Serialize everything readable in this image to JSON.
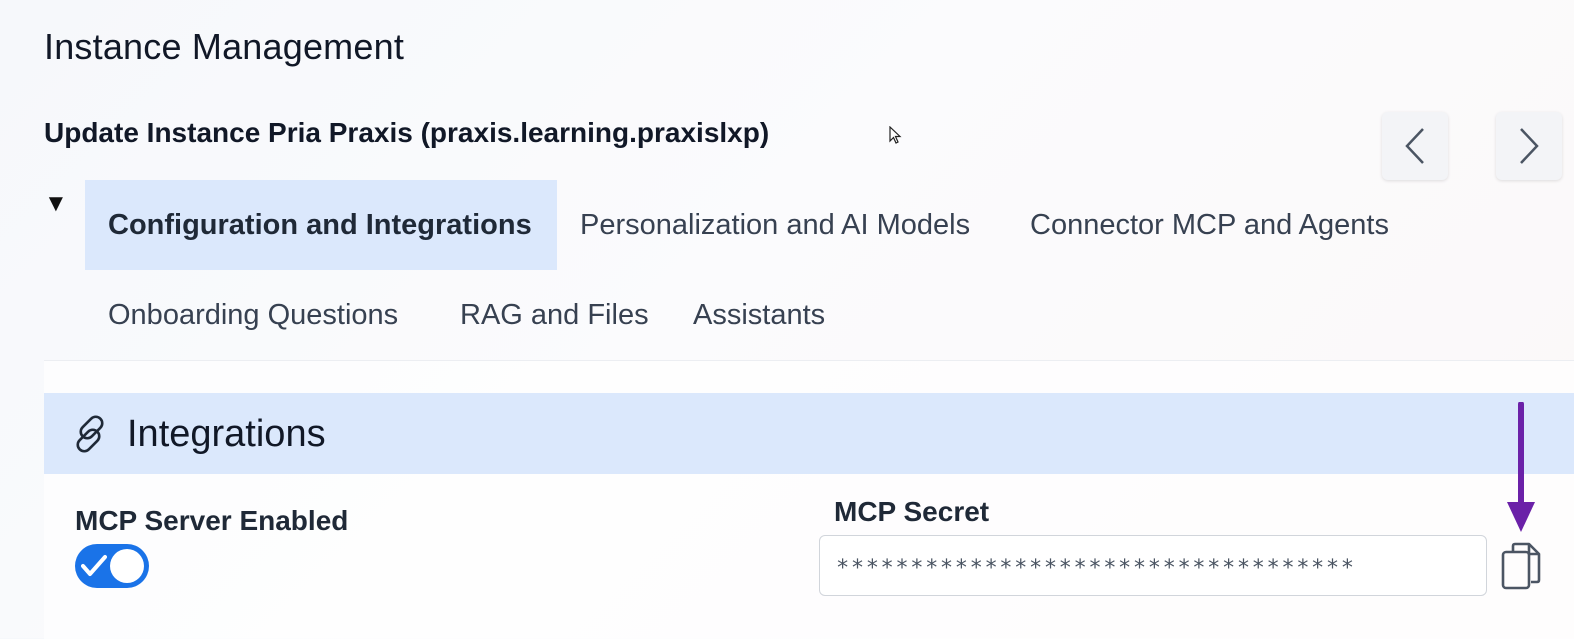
{
  "page": {
    "title": "Instance Management",
    "subtitle": "Update Instance Pria Praxis (praxis.learning.praxislxp)"
  },
  "nav": {
    "prev_icon": "chevron-left-icon",
    "next_icon": "chevron-right-icon"
  },
  "tabs": [
    {
      "label": "Configuration and Integrations",
      "active": true
    },
    {
      "label": "Personalization and AI Models",
      "active": false
    },
    {
      "label": "Connector MCP and Agents",
      "active": false
    },
    {
      "label": "Onboarding Questions",
      "active": false
    },
    {
      "label": "RAG and Files",
      "active": false
    },
    {
      "label": "Assistants",
      "active": false
    }
  ],
  "section": {
    "title": "Integrations",
    "icon": "link-icon"
  },
  "fields": {
    "mcp_server_enabled": {
      "label": "MCP Server Enabled",
      "value": true
    },
    "mcp_secret": {
      "label": "MCP Secret",
      "value": "***********************************"
    }
  },
  "colors": {
    "accent": "#1a73e8",
    "tab_active_bg": "#dbe8fc",
    "annotation_arrow": "#6b21a8"
  }
}
